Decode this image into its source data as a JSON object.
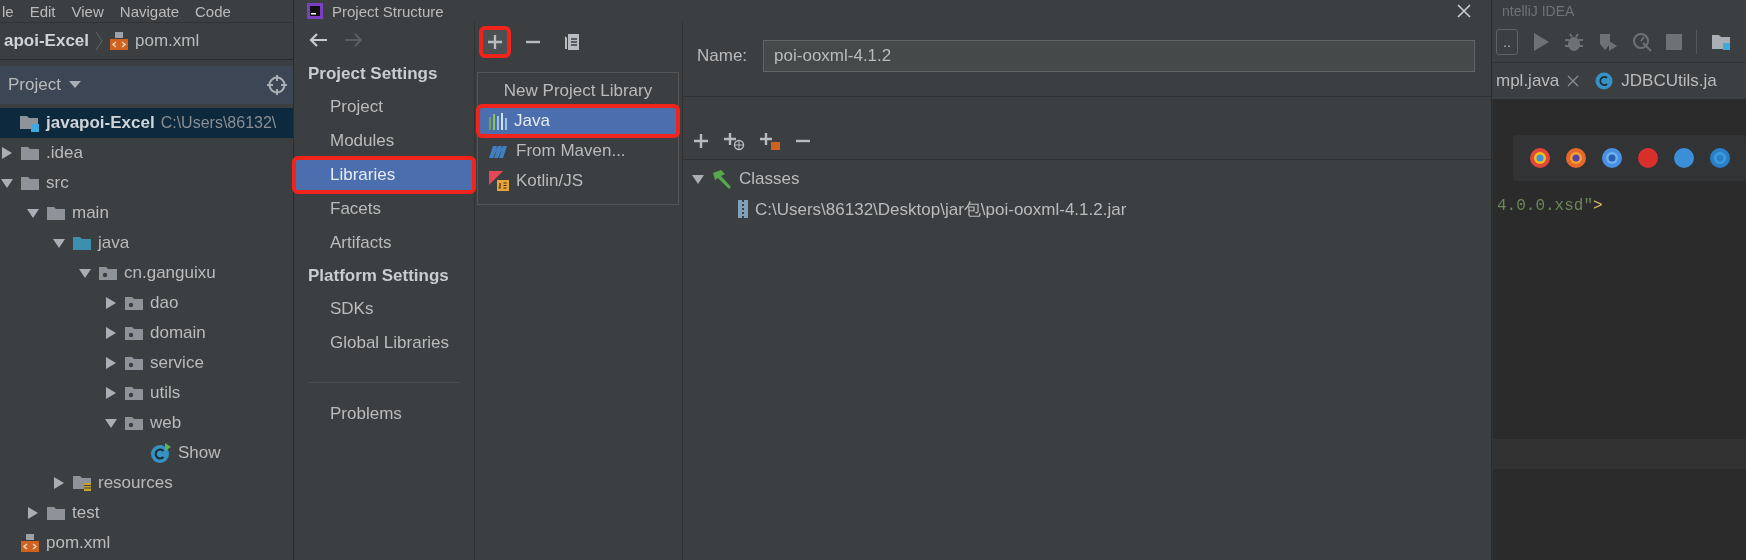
{
  "menu_bar": {
    "items": [
      "le",
      "Edit",
      "View",
      "Navigate",
      "Code"
    ]
  },
  "breadcrumb": {
    "items": [
      {
        "label": "apoi-Excel"
      },
      {
        "label": "pom.xml",
        "kind": "xml"
      }
    ]
  },
  "project_panel": {
    "title": "Project",
    "tree": [
      {
        "label": "javapoi-Excel",
        "kind": "module",
        "path": "C:\\Users\\86132\\",
        "selected": true,
        "children": [
          {
            "label": ".idea",
            "kind": "folder",
            "expanded": false,
            "selected": false
          },
          {
            "label": "src",
            "kind": "folder",
            "expanded": true,
            "selected": false,
            "children": [
              {
                "label": "main",
                "kind": "folder",
                "expanded": true,
                "selected": false,
                "children": [
                  {
                    "label": "java",
                    "kind": "source",
                    "expanded": true,
                    "selected": false,
                    "children": [
                      {
                        "label": "cn.ganguixu",
                        "kind": "package",
                        "expanded": true,
                        "selected": false,
                        "children": [
                          {
                            "label": "dao",
                            "kind": "package",
                            "expanded": false,
                            "selected": false
                          },
                          {
                            "label": "domain",
                            "kind": "package",
                            "expanded": false,
                            "selected": false
                          },
                          {
                            "label": "service",
                            "kind": "package",
                            "expanded": false,
                            "selected": false
                          },
                          {
                            "label": "utils",
                            "kind": "package",
                            "expanded": false,
                            "selected": false
                          },
                          {
                            "label": "web",
                            "kind": "package",
                            "expanded": true,
                            "selected": false,
                            "children": [
                              {
                                "label": "Show",
                                "kind": "class",
                                "selected": false
                              }
                            ]
                          }
                        ]
                      }
                    ]
                  },
                  {
                    "label": "resources",
                    "kind": "resources",
                    "expanded": false,
                    "selected": false
                  }
                ]
              },
              {
                "label": "test",
                "kind": "folder",
                "expanded": false,
                "selected": false
              }
            ]
          },
          {
            "label": "pom.xml",
            "kind": "xml",
            "selected": false
          }
        ]
      }
    ]
  },
  "dialog": {
    "title": "Project Structure",
    "nav_sections": [
      {
        "heading": "Project Settings",
        "items": [
          {
            "label": "Project",
            "selected": false,
            "annotated": false
          },
          {
            "label": "Modules",
            "selected": false,
            "annotated": false
          },
          {
            "label": "Libraries",
            "selected": true,
            "annotated": true
          },
          {
            "label": "Facets",
            "selected": false,
            "annotated": false
          },
          {
            "label": "Artifacts",
            "selected": false,
            "annotated": false
          }
        ]
      },
      {
        "heading": "Platform Settings",
        "items": [
          {
            "label": "SDKs",
            "selected": false,
            "annotated": false
          },
          {
            "label": "Global Libraries",
            "selected": false,
            "annotated": false
          }
        ]
      },
      {
        "items": [
          {
            "label": "Problems",
            "selected": false,
            "annotated": false
          }
        ]
      }
    ],
    "library_toolbar": [
      {
        "kind": "add",
        "annotated": true
      },
      {
        "kind": "remove",
        "annotated": false
      },
      {
        "kind": "copy",
        "annotated": false
      }
    ],
    "add_menu": {
      "header": "New Project Library",
      "items": [
        {
          "label": "Java",
          "kind": "java",
          "selected": true,
          "annotated": true
        },
        {
          "label": "From Maven...",
          "kind": "maven",
          "selected": false,
          "annotated": false
        },
        {
          "label": "Kotlin/JS",
          "kind": "kotlin",
          "selected": false,
          "annotated": false
        }
      ]
    },
    "name_label": "Name:",
    "name_value": "poi-ooxml-4.1.2",
    "roots_toolbar": [
      {
        "kind": "add"
      },
      {
        "kind": "add-url"
      },
      {
        "kind": "add-jar"
      },
      {
        "kind": "remove"
      }
    ],
    "roots_tree": [
      {
        "label": "Classes",
        "kind": "classes",
        "expanded": true,
        "selected": false,
        "children": [
          {
            "label": "C:\\Users\\86132\\Desktop\\jar包\\poi-ooxml-4.1.2.jar",
            "kind": "jar",
            "selected": false
          }
        ]
      }
    ]
  },
  "editor_window": {
    "title": "ntelliJ IDEA",
    "run_config": "..",
    "tabs": [
      {
        "label": "mpl.java",
        "kind": "plain",
        "closable": true,
        "selected": false
      },
      {
        "label": "JDBCUtils.ja",
        "kind": "class",
        "closable": false,
        "selected": false
      }
    ],
    "code_line": [
      {
        "text": "4.0.0.xsd\"",
        "kind": "string"
      },
      {
        "text": ">",
        "kind": "tag"
      }
    ]
  }
}
